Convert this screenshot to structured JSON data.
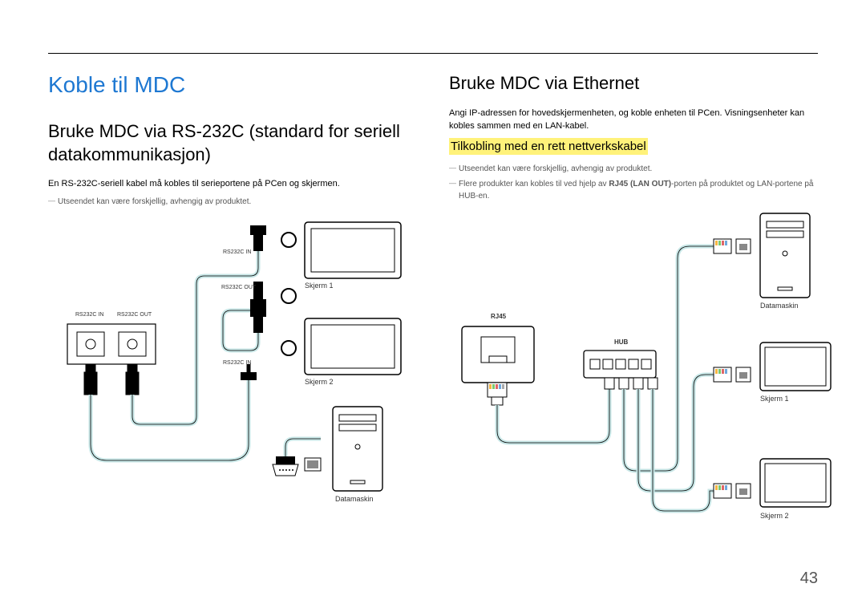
{
  "page": {
    "number": "43"
  },
  "left": {
    "title": "Koble til MDC",
    "heading": "Bruke MDC via RS-232C (standard for seriell datakommunikasjon)",
    "para1": "En RS-232C-seriell kabel må kobles til serieportene på PCen og skjermen.",
    "note1": "Utseendet kan være forskjellig, avhengig av produktet.",
    "labels": {
      "rs232c_in_top": "RS232C IN",
      "rs232c_out_top": "RS232C OUT",
      "rs232c_in_mid1": "RS232C IN",
      "rs232c_out_mid": "RS232C OUT",
      "rs232c_in_mid2": "RS232C IN",
      "skjerm1": "Skjerm 1",
      "skjerm2": "Skjerm 2",
      "datamaskin": "Datamaskin"
    }
  },
  "right": {
    "heading": "Bruke MDC via Ethernet",
    "para1": "Angi IP-adressen for hovedskjermenheten, og koble enheten til PCen. Visningsenheter kan kobles sammen med en LAN-kabel.",
    "subheading": "Tilkobling med en rett nettverkskabel",
    "note1": "Utseendet kan være forskjellig, avhengig av produktet.",
    "note2_pre": "Flere produkter kan kobles til ved hjelp av ",
    "note2_bold": "RJ45 (LAN OUT)",
    "note2_post": "-porten på produktet og LAN-portene på HUB-en.",
    "labels": {
      "rj45": "RJ45",
      "hub": "HUB",
      "datamaskin": "Datamaskin",
      "skjerm1": "Skjerm 1",
      "skjerm2": "Skjerm 2"
    }
  }
}
